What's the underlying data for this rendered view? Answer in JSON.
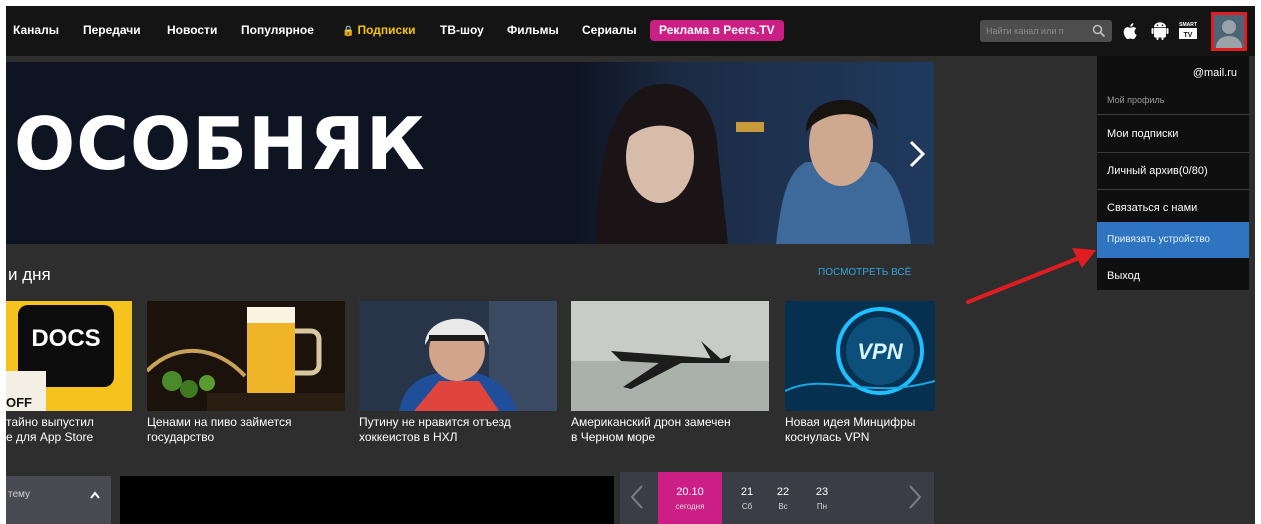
{
  "nav": {
    "items": [
      {
        "label": "Каналы"
      },
      {
        "label": "Передачи"
      },
      {
        "label": "Новости"
      },
      {
        "label": "Популярное"
      },
      {
        "label": "Подписки"
      },
      {
        "label": "ТВ-шоу"
      },
      {
        "label": "Фильмы"
      },
      {
        "label": "Сериалы"
      }
    ],
    "ad_label": "Реклама в Peers.TV",
    "search_placeholder": "Найти канал или п",
    "platforms": [
      "apple-icon",
      "android-icon",
      "smart-tv-icon"
    ],
    "smart_tv_text": "SMART TV"
  },
  "banner": {
    "title": "ОСОБНЯК"
  },
  "section": {
    "title": "и дня",
    "see_all": "посмотреть всё"
  },
  "news": [
    {
      "caption": "тайно выпустил\nе для App Store",
      "thumb_text": "DOCS",
      "thumb_text2": "OFF"
    },
    {
      "caption": "Ценами на пиво займется\nгосударство"
    },
    {
      "caption": "Путину не нравится отъезд\nхоккеистов в НХЛ"
    },
    {
      "caption": "Американский дрон замечен\nв Черном море"
    },
    {
      "caption": "Новая идея Минцифры\nкоснулась VPN",
      "thumb_text": "VPN"
    }
  ],
  "bottom": {
    "topic_label": "тему",
    "days": [
      {
        "date": "20.10",
        "weekday": "сегодня",
        "active": true
      },
      {
        "date": "21",
        "weekday": "Сб",
        "active": false
      },
      {
        "date": "22",
        "weekday": "Вс",
        "active": false
      },
      {
        "date": "23",
        "weekday": "Пн",
        "active": false
      }
    ]
  },
  "dropdown": {
    "email": "@mail.ru",
    "profile": "Мой профиль",
    "items": [
      {
        "label": "Мои подписки"
      },
      {
        "label": "Личный архив(0/80)"
      },
      {
        "label": "Связаться с нами"
      },
      {
        "label": "Привязать устройство"
      },
      {
        "label": "Выход"
      }
    ]
  },
  "colors": {
    "accent_pink": "#cc1f86",
    "highlight_blue": "#2e74c0",
    "link_blue": "#2fa6de",
    "subscription_yellow": "#f5c400",
    "annotation_red": "#e11d24"
  }
}
